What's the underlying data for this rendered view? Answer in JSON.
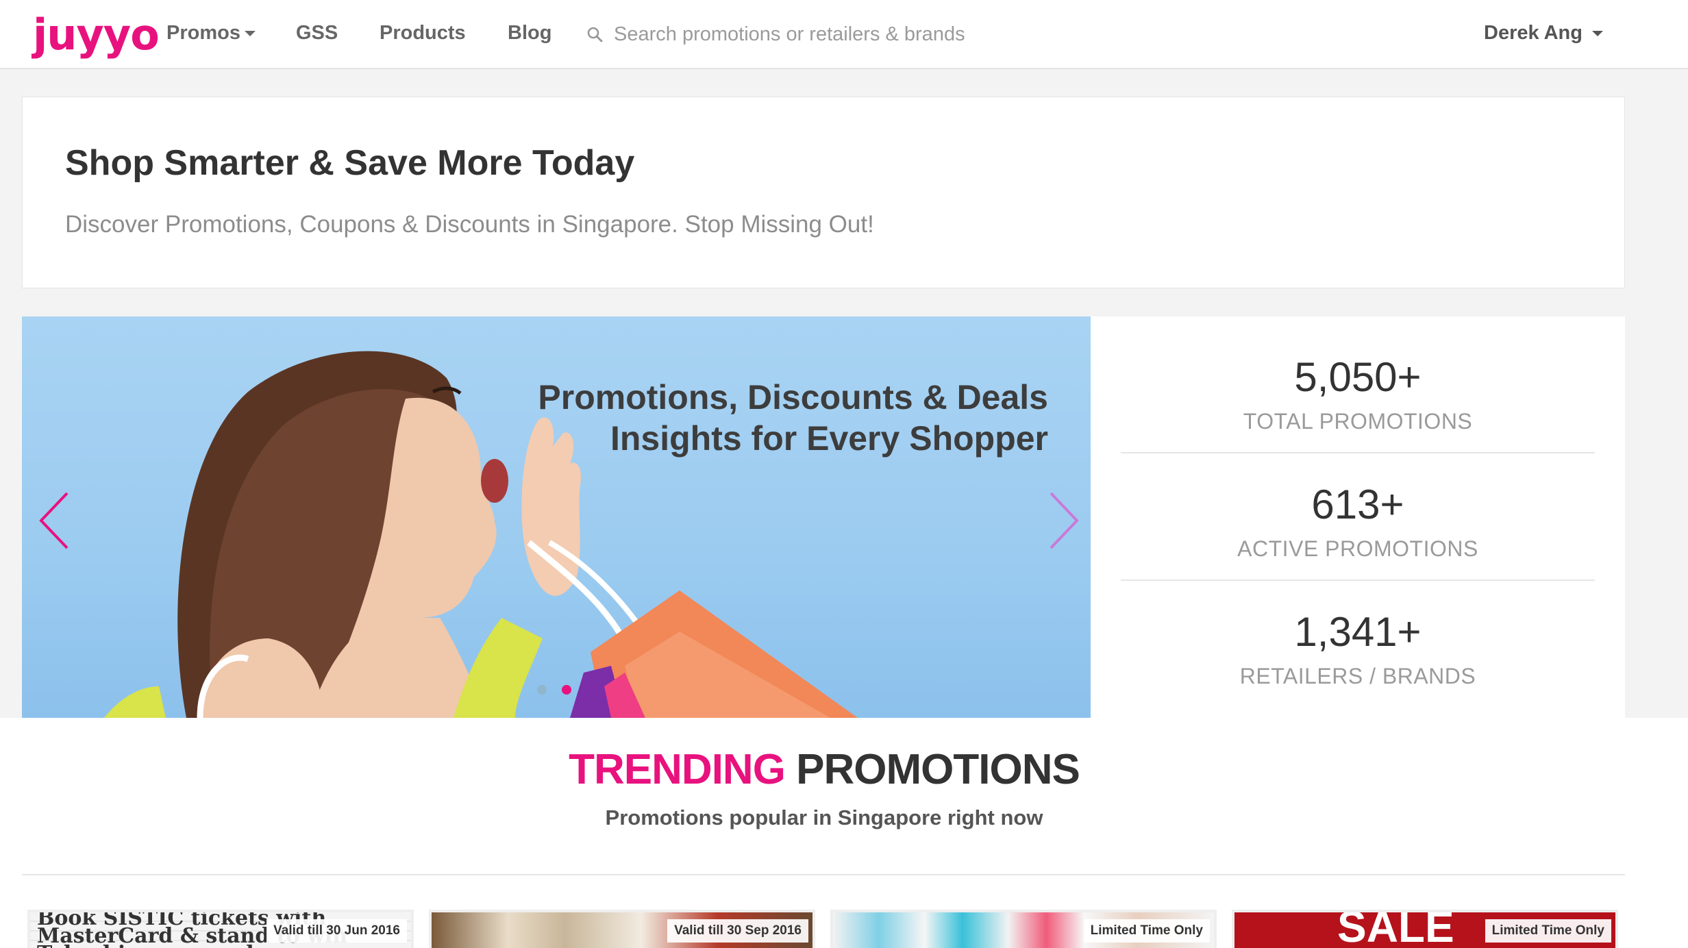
{
  "navbar": {
    "logo": "juyyo",
    "promos": "Promos",
    "gss": "GSS",
    "products": "Products",
    "blog": "Blog",
    "search_placeholder": "Search promotions or retailers & brands",
    "user": "Derek Ang"
  },
  "hero": {
    "title": "Shop Smarter & Save More Today",
    "subtitle": "Discover Promotions, Coupons & Discounts in Singapore. Stop Missing Out!"
  },
  "carousel": {
    "caption_line1": "Promotions, Discounts & Deals",
    "caption_line2": "Insights for Every Shopper",
    "slide_count": 2,
    "active_slide": 2,
    "arrow_color": "#e8127e"
  },
  "stats": [
    {
      "value": "5,050+",
      "label": "TOTAL PROMOTIONS"
    },
    {
      "value": "613+",
      "label": "ACTIVE PROMOTIONS"
    },
    {
      "value": "1,341+",
      "label": "RETAILERS / BRANDS"
    }
  ],
  "trending": {
    "title_highlight": "TRENDING",
    "title_rest": "PROMOTIONS",
    "subtitle": "Promotions popular in Singapore right now",
    "cards": [
      {
        "badge": "Valid till 30 Jun 2016",
        "image_text": "Book SISTIC tickets with MasterCard & stand to win Takashimaya vouchers"
      },
      {
        "badge": "Valid till 30 Sep 2016"
      },
      {
        "badge": "Limited Time Only"
      },
      {
        "badge": "Limited Time Only",
        "image_text": "SALE"
      }
    ]
  },
  "colors": {
    "brand": "#e8127e",
    "text_dark": "#333333",
    "text_muted": "#8c8c8c"
  }
}
